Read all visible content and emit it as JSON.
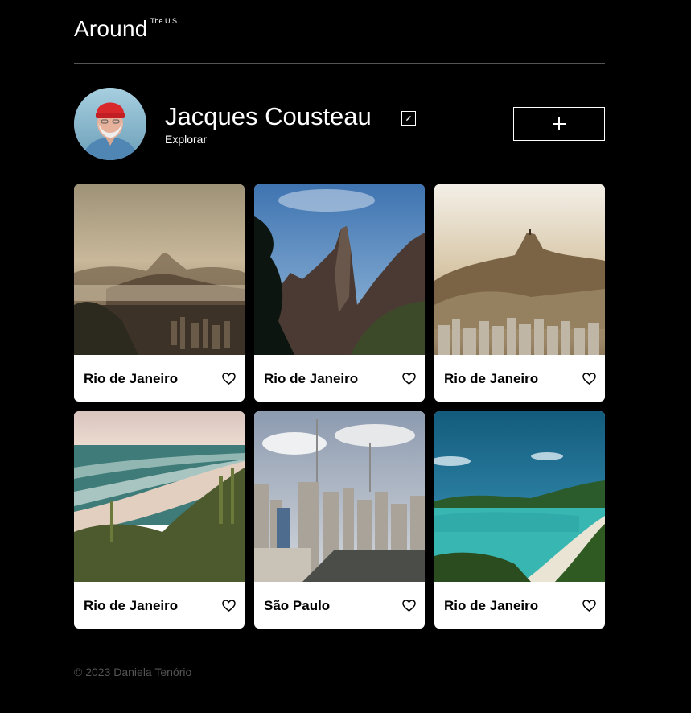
{
  "header": {
    "logo": "Around",
    "logo_sup": "The U.S."
  },
  "profile": {
    "name": "Jacques Cousteau",
    "subtitle": "Explorar"
  },
  "cards": [
    {
      "title": "Rio de Janeiro",
      "image": "misty-sugarloaf-mountain"
    },
    {
      "title": "Rio de Janeiro",
      "image": "rocky-peaks-blue-sky"
    },
    {
      "title": "Rio de Janeiro",
      "image": "corcovado-city-sunset"
    },
    {
      "title": "Rio de Janeiro",
      "image": "beach-waves-cactus"
    },
    {
      "title": "São Paulo",
      "image": "city-skyline-towers"
    },
    {
      "title": "Rio de Janeiro",
      "image": "turquoise-bay-beach"
    }
  ],
  "footer": {
    "text": "© 2023 Daniela Tenório"
  },
  "colors": {
    "background": "#000000",
    "card": "#ffffff",
    "divider": "#545454",
    "footer_text": "#545454"
  }
}
